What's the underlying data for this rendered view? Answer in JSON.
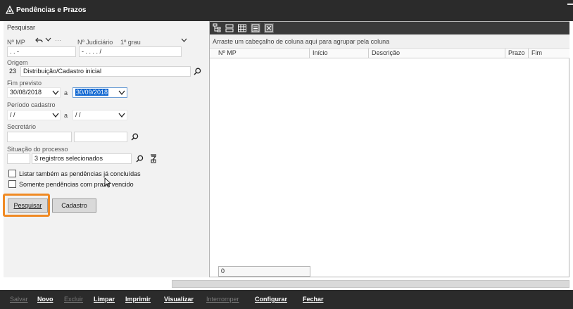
{
  "window": {
    "title": "Pendências e Prazos"
  },
  "search_panel": {
    "header": "Pesquisar",
    "nmp_label": "Nº MP",
    "nmp_value": ". .      -",
    "nmp_extra": "···",
    "judicial_label": "Nº Judiciário",
    "degree_label": "1º grau",
    "judicial_value": "- .   . . .   /",
    "origin_label": "Origem",
    "origin_code": "23",
    "origin_value": "Distribuição/Cadastro inicial",
    "end_label": "Fim previsto",
    "end_from": "30/08/2018",
    "end_sep": "a",
    "end_to": "30/09/2018",
    "period_label": "Período cadastro",
    "period_from": " / /",
    "period_sep": "a",
    "period_to": " / /",
    "secretary_label": "Secretário",
    "status_label": "Situação do processo",
    "status_value": "3 registros selecionados",
    "check_concluded": "Listar também as pendências já concluídas",
    "check_overdue": "Somente pendências com prazo vencido",
    "search_button": "Pesquisar",
    "register_button": "Cadastro"
  },
  "grid": {
    "group_hint": "Arraste um cabeçalho de coluna aqui para agrupar pela coluna",
    "columns": [
      "Nº MP",
      "Início",
      "Descrição",
      "Prazo",
      "Fim"
    ],
    "count": "0"
  },
  "bottom_bar": {
    "items": [
      {
        "label": "Salvar",
        "enabled": false
      },
      {
        "label": "Novo",
        "enabled": true
      },
      {
        "label": "Excluir",
        "enabled": false
      },
      {
        "label": "Limpar",
        "enabled": true
      },
      {
        "label": "Imprimir",
        "enabled": true
      },
      {
        "label": "Visualizar",
        "enabled": true
      },
      {
        "label": "Interromper",
        "enabled": false
      },
      {
        "label": "Configurar",
        "enabled": true
      },
      {
        "label": "Fechar",
        "enabled": true
      }
    ]
  },
  "colors": {
    "focus": "#f08a24",
    "selection": "#0a64d1",
    "dark_bar": "#2b2b2b"
  }
}
